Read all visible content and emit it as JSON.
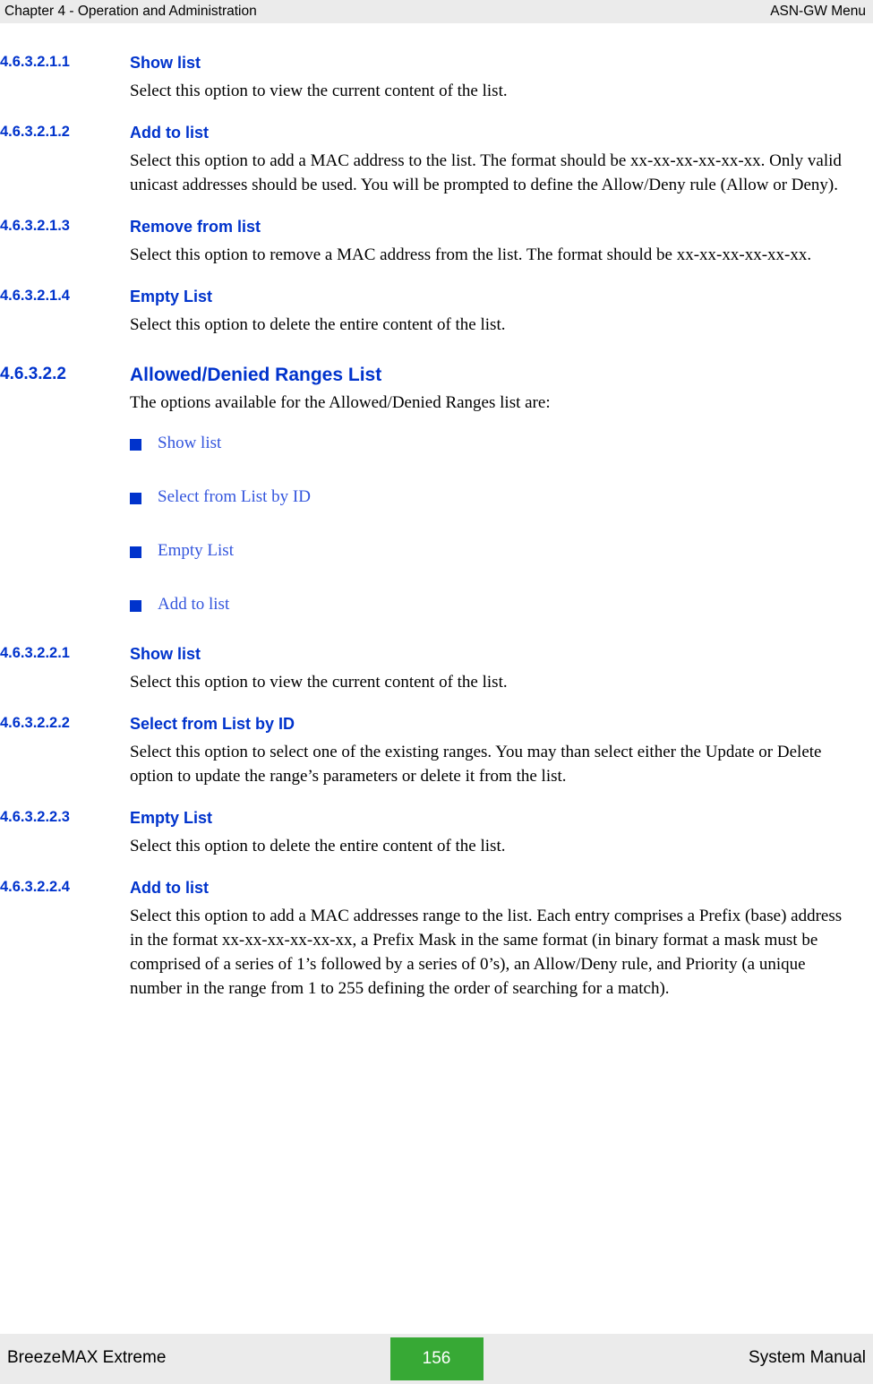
{
  "header": {
    "left": "Chapter 4 - Operation and Administration",
    "right": "ASN-GW Menu"
  },
  "sections": [
    {
      "number": "4.6.3.2.1.1",
      "title": "Show list",
      "body": "Select this option to view the current content of the list."
    },
    {
      "number": "4.6.3.2.1.2",
      "title": "Add to list",
      "body": "Select this option to add a MAC address to the list. The format should be xx-xx-xx-xx-xx-xx. Only valid unicast addresses should be used. You will be prompted to define the Allow/Deny rule (Allow or Deny)."
    },
    {
      "number": "4.6.3.2.1.3",
      "title": "Remove from list",
      "body": "Select this option to remove a MAC address from the list. The format should be xx-xx-xx-xx-xx-xx."
    },
    {
      "number": "4.6.3.2.1.4",
      "title": "Empty List",
      "body": "Select this option to delete the entire content of the list."
    },
    {
      "number": "4.6.3.2.2",
      "title": "Allowed/Denied Ranges List",
      "body": "The options available for the Allowed/Denied Ranges list are:"
    },
    {
      "number": "4.6.3.2.2.1",
      "title": "Show list",
      "body": "Select this option to view the current content of the list."
    },
    {
      "number": "4.6.3.2.2.2",
      "title": "Select from List by ID",
      "body": "Select this option to select one of the existing ranges. You may than select either the Update or Delete option to update the range’s parameters or delete it from the list."
    },
    {
      "number": "4.6.3.2.2.3",
      "title": "Empty List",
      "body": "Select this option to delete the entire content of the list."
    },
    {
      "number": "4.6.3.2.2.4",
      "title": "Add to list",
      "body": "Select this option to add a MAC addresses range to the list. Each entry comprises a Prefix (base) address in the format xx-xx-xx-xx-xx-xx, a Prefix Mask in the same format (in binary format a mask must be comprised of a series of 1’s followed by a series of 0’s), an Allow/Deny rule, and Priority (a unique number in the range from 1 to 255 defining the order of searching for a match)."
    }
  ],
  "bullets": [
    "Show list",
    "Select from List by ID",
    "Empty List",
    "Add to list"
  ],
  "footer": {
    "left": "BreezeMAX Extreme",
    "page": "156",
    "right": "System Manual"
  },
  "colors": {
    "heading_blue": "#0033CC",
    "bullet_blue": "#3355DD",
    "page_badge_green": "#37A935",
    "band_gray": "#EBEBEB"
  }
}
